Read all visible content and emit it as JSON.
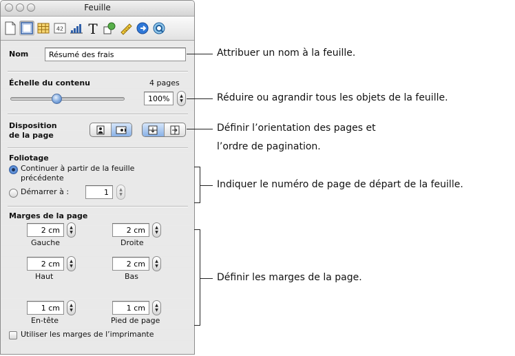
{
  "window": {
    "title": "Feuille",
    "toolbar_icons": [
      "document-icon",
      "sheet-icon",
      "table-icon",
      "cell-format-icon",
      "chart-icon",
      "text-icon",
      "graphic-icon",
      "metrics-icon",
      "hyperlink-icon",
      "quicktime-icon"
    ],
    "selected_tab": "sheet-icon"
  },
  "inspector": {
    "name_label": "Nom",
    "name_value": "Résumé des frais",
    "scale_label": "Échelle du contenu",
    "pages_count": "4 pages",
    "scale_value": "100%",
    "scale_slider_fraction": 0.4,
    "layout_label_line1": "Disposition",
    "layout_label_line2": "de la page",
    "orientation_options": [
      "portrait-icon",
      "landscape-icon"
    ],
    "orientation_selected": "landscape-icon",
    "page_order_options": [
      "top-to-bottom-icon",
      "left-to-right-icon"
    ],
    "page_order_selected": "top-to-bottom-icon",
    "numbering_label": "Foliotage",
    "continue_line1": "Continuer à partir de la feuille",
    "continue_line2": "précédente",
    "start_at_label": "Démarrer à :",
    "start_at_value": "1",
    "numbering_selected": "continue",
    "margins_label": "Marges de la page",
    "margins": [
      {
        "value": "2 cm",
        "label": "Gauche"
      },
      {
        "value": "2 cm",
        "label": "Droite"
      },
      {
        "value": "2 cm",
        "label": "Haut"
      },
      {
        "value": "2 cm",
        "label": "Bas"
      },
      {
        "value": "1 cm",
        "label": "En-tête"
      },
      {
        "value": "1 cm",
        "label": "Pied de page"
      }
    ],
    "printer_margins_label": "Utiliser les marges de l’imprimante",
    "printer_margins_checked": false
  },
  "callouts": {
    "name": "Attribuer un nom à la feuille.",
    "scale": "Réduire ou agrandir tous les objets de la feuille.",
    "layout_line1": "Définir l’orientation des pages et",
    "layout_line2": "l’ordre de pagination.",
    "numbering": "Indiquer le numéro de page de départ de la feuille.",
    "margins": "Définir les marges de la page."
  },
  "colors": {
    "selection_blue": "#6e9fe1",
    "pane_background": "#e9e9e9"
  }
}
